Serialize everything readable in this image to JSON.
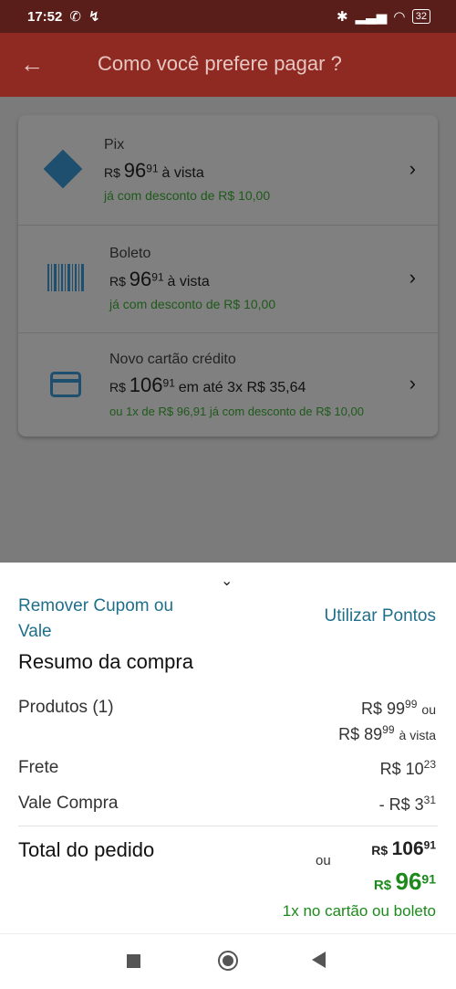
{
  "status_bar": {
    "time": "17:52",
    "battery": "32"
  },
  "header": {
    "title": "Como você prefere pagar ?"
  },
  "payment_options": [
    {
      "name": "Pix",
      "currency": "R$",
      "int": "96",
      "cents": "91",
      "suffix": "à vista",
      "note": "já com desconto de R$ 10,00",
      "icon": "pix-icon"
    },
    {
      "name": "Boleto",
      "currency": "R$",
      "int": "96",
      "cents": "91",
      "suffix": "à vista",
      "note": "já com desconto de R$ 10,00",
      "icon": "barcode-icon"
    },
    {
      "name": "Novo cartão crédito",
      "currency": "R$",
      "int": "106",
      "cents": "91",
      "suffix": "em até 3x R$ 35,64",
      "note": "ou 1x de R$ 96,91  já com desconto de R$ 10,00",
      "icon": "credit-card-icon"
    }
  ],
  "summary": {
    "remove_coupon": "Remover Cupom ou Vale",
    "use_points": "Utilizar Pontos",
    "title": "Resumo da compra",
    "products_label": "Produtos (1)",
    "products_price_int": "R$ 99",
    "products_price_cents": "99",
    "products_price_suffix": "ou",
    "products_cash_int": "R$ 89",
    "products_cash_cents": "99",
    "products_cash_suffix": "à vista",
    "shipping_label": "Frete",
    "shipping_int": "R$ 10",
    "shipping_cents": "23",
    "voucher_label": "Vale Compra",
    "voucher_int": "- R$ 3",
    "voucher_cents": "31",
    "total_label": "Total do pedido",
    "or": "ou",
    "total_currency": "R$",
    "total_int": "106",
    "total_cents": "91",
    "discount_currency": "R$",
    "discount_int": "96",
    "discount_cents": "91",
    "footer_note": "1x no cartão ou boleto"
  },
  "colors": {
    "accent": "#8f2a22",
    "link": "#1f6f8b",
    "green": "#1b8a1b",
    "icon": "#1e4f6e"
  }
}
